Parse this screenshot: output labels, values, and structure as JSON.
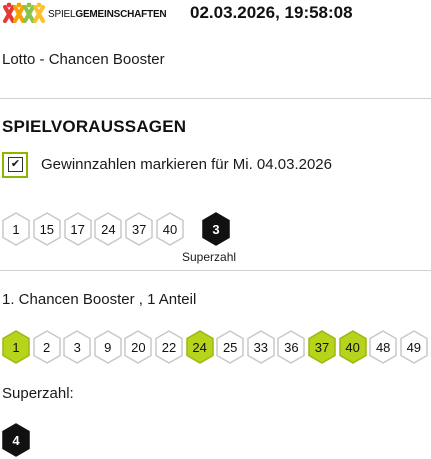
{
  "header": {
    "logo_text_light": "SPIEL",
    "logo_text_bold": "GEMEINSCHAFTEN",
    "datetime": "02.03.2026, 19:58:08"
  },
  "game": {
    "subtitle": "Lotto - Chancen Booster"
  },
  "predictions": {
    "section_title": "SPIELVORAUSSAGEN",
    "mark_label": "Gewinnzahlen markieren für Mi. 04.03.2026",
    "mark_checked": true,
    "winning_numbers": [
      "1",
      "15",
      "17",
      "24",
      "37",
      "40"
    ],
    "superzahl": "3",
    "superzahl_caption": "Superzahl"
  },
  "ticket": {
    "title": "1. Chancen Booster , 1 Anteil",
    "numbers": [
      {
        "value": "1",
        "hit": true
      },
      {
        "value": "2",
        "hit": false
      },
      {
        "value": "3",
        "hit": false
      },
      {
        "value": "9",
        "hit": false
      },
      {
        "value": "20",
        "hit": false
      },
      {
        "value": "22",
        "hit": false
      },
      {
        "value": "24",
        "hit": true
      },
      {
        "value": "25",
        "hit": false
      },
      {
        "value": "33",
        "hit": false
      },
      {
        "value": "36",
        "hit": false
      },
      {
        "value": "37",
        "hit": true
      },
      {
        "value": "40",
        "hit": true
      },
      {
        "value": "48",
        "hit": false
      },
      {
        "value": "49",
        "hit": false
      }
    ],
    "superzahl_label": "Superzahl:",
    "superzahl": "4"
  },
  "colors": {
    "hit": "#b7d31b",
    "hit_border": "#9ab80f",
    "outline": "#c8c8c8",
    "dark": "#111111",
    "logo_x_colors": [
      "#e53935",
      "#f5a300",
      "#8bc34a",
      "#ffd600"
    ]
  }
}
